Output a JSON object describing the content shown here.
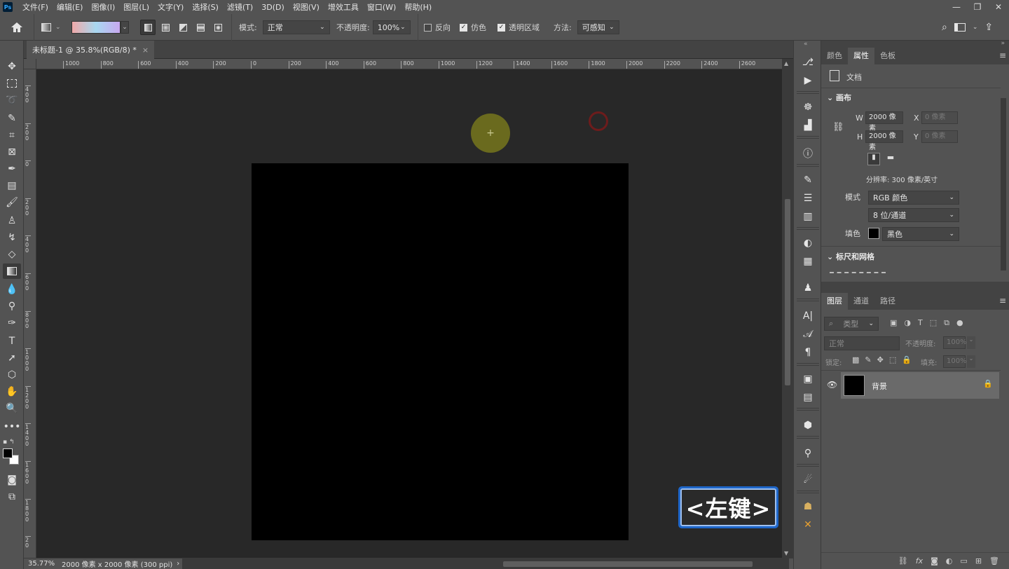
{
  "app": {
    "logo": "Ps"
  },
  "menubar": {
    "items": [
      "文件(F)",
      "编辑(E)",
      "图像(I)",
      "图层(L)",
      "文字(Y)",
      "选择(S)",
      "滤镜(T)",
      "3D(D)",
      "视图(V)",
      "增效工具",
      "窗口(W)",
      "帮助(H)"
    ],
    "window_controls": [
      "—",
      "❐",
      "✕"
    ]
  },
  "options": {
    "mode_label": "模式:",
    "mode_value": "正常",
    "opacity_label": "不透明度:",
    "opacity_value": "100%",
    "reverse_label": "反向",
    "dither_label": "仿色",
    "transparency_label": "透明区域",
    "method_label": "方法:",
    "method_value": "可感知",
    "gradient_colors": [
      "#f0a8a8",
      "#a8d8f0",
      "#c8a8f0"
    ]
  },
  "document": {
    "tab_title": "未标题-1 @ 35.8%(RGB/8) *",
    "tab_close": "×",
    "canvas_color": "#000000"
  },
  "hruler": [
    "1000",
    "800",
    "600",
    "400",
    "200",
    "0",
    "200",
    "400",
    "600",
    "800",
    "1000",
    "1200",
    "1400",
    "1600",
    "1800",
    "2000",
    "2200",
    "2400",
    "2600"
  ],
  "vruler": [
    "4 0 0",
    "2 0 0",
    "0",
    "2 0 0",
    "4 0 0",
    "6 0 0",
    "8 0 0",
    "1 0 0 0",
    "1 2 0 0",
    "1 4 0 0",
    "1 6 0 0",
    "1 8 0 0",
    "2 0"
  ],
  "status": {
    "zoom": "35.77%",
    "doc_info": "2000 像素 x 2000 像素 (300 ppi)",
    "arrow": "›"
  },
  "overlay": {
    "keycap": "<左键>"
  },
  "properties": {
    "tabs": [
      "颜色",
      "属性",
      "色板"
    ],
    "active_tab": "属性",
    "doc_label": "文档",
    "canvas_section": "画布",
    "w_label": "W",
    "w_value": "2000 像素",
    "h_label": "H",
    "h_value": "2000 像素",
    "x_label": "X",
    "x_placeholder": "0 像素",
    "y_label": "Y",
    "y_placeholder": "0 像素",
    "resolution": "分辨率: 300 像素/英寸",
    "mode_label": "模式",
    "mode_value": "RGB 颜色",
    "depth_value": "8 位/通道",
    "fill_label": "填色",
    "fill_value": "黑色",
    "fill_color": "#000000",
    "rulers_section": "标尺和网格"
  },
  "layers": {
    "tabs": [
      "图层",
      "通道",
      "路径"
    ],
    "active_tab": "图层",
    "filter_placeholder": "类型",
    "blend_mode": "正常",
    "opacity_label": "不透明度:",
    "opacity_value": "100%",
    "lock_label": "锁定:",
    "fill_label": "填充:",
    "fill_value": "100%",
    "layer_name": "背景"
  }
}
